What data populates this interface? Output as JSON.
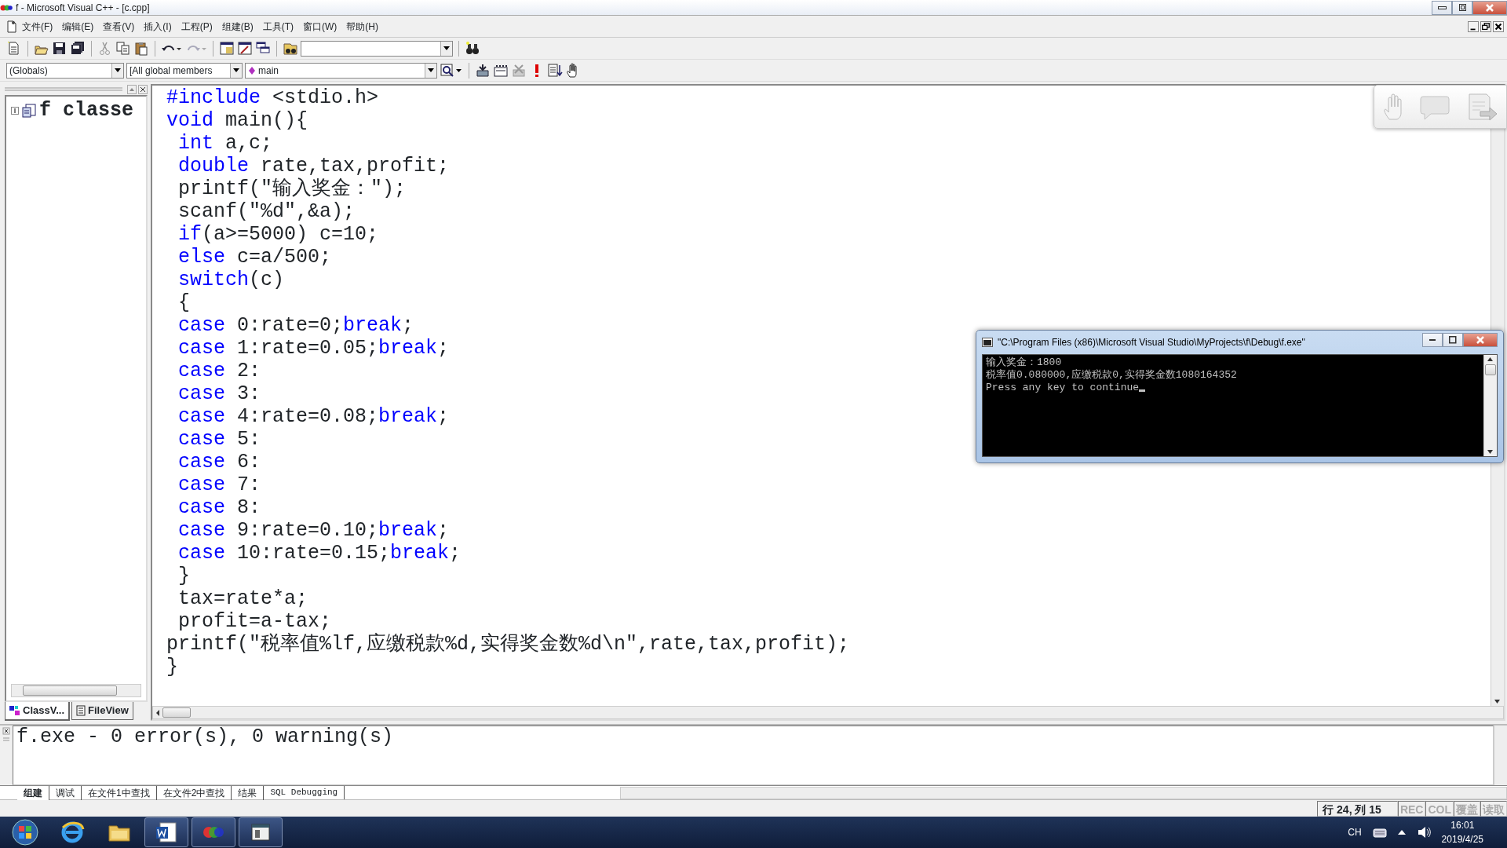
{
  "window": {
    "title": "f - Microsoft Visual C++ - [c.cpp]"
  },
  "menu": [
    "文件(F)",
    "编辑(E)",
    "查看(V)",
    "插入(I)",
    "工程(P)",
    "组建(B)",
    "工具(T)",
    "窗口(W)",
    "帮助(H)"
  ],
  "wizard_bar": {
    "class": "(Globals)",
    "filter": "[All global members",
    "function": "main"
  },
  "class_view": {
    "tree": [
      {
        "label": "f classe",
        "expanded": false
      }
    ],
    "tabs": [
      {
        "label": "ClassV...",
        "selected": true
      },
      {
        "label": "FileView",
        "selected": false
      }
    ]
  },
  "editor": {
    "lines": [
      [
        {
          "kind": "keyword",
          "text": "#include"
        },
        {
          "kind": "plain",
          "text": " <stdio.h>"
        }
      ],
      [
        {
          "kind": "keyword",
          "text": "void"
        },
        {
          "kind": "plain",
          "text": " main(){"
        }
      ],
      [
        {
          "kind": "keyword",
          "text": " int"
        },
        {
          "kind": "plain",
          "text": " a,c;"
        }
      ],
      [
        {
          "kind": "keyword",
          "text": " double"
        },
        {
          "kind": "plain",
          "text": " rate,tax,profit;"
        }
      ],
      [
        {
          "kind": "plain",
          "text": " printf(\"输入奖金：\");"
        }
      ],
      [
        {
          "kind": "plain",
          "text": " scanf(\"%d\",&a);"
        }
      ],
      [
        {
          "kind": "keyword",
          "text": " if"
        },
        {
          "kind": "plain",
          "text": "(a>=5000) c=10;"
        }
      ],
      [
        {
          "kind": "keyword",
          "text": " else"
        },
        {
          "kind": "plain",
          "text": " c=a/500;"
        }
      ],
      [
        {
          "kind": "keyword",
          "text": " switch"
        },
        {
          "kind": "plain",
          "text": "(c)"
        }
      ],
      [
        {
          "kind": "plain",
          "text": " {"
        }
      ],
      [
        {
          "kind": "keyword",
          "text": " case"
        },
        {
          "kind": "plain",
          "text": " 0:rate=0;"
        },
        {
          "kind": "keyword",
          "text": "break"
        },
        {
          "kind": "plain",
          "text": ";"
        }
      ],
      [
        {
          "kind": "keyword",
          "text": " case"
        },
        {
          "kind": "plain",
          "text": " 1:rate=0.05;"
        },
        {
          "kind": "keyword",
          "text": "break"
        },
        {
          "kind": "plain",
          "text": ";"
        }
      ],
      [
        {
          "kind": "keyword",
          "text": " case"
        },
        {
          "kind": "plain",
          "text": " 2:"
        }
      ],
      [
        {
          "kind": "keyword",
          "text": " case"
        },
        {
          "kind": "plain",
          "text": " 3:"
        }
      ],
      [
        {
          "kind": "keyword",
          "text": " case"
        },
        {
          "kind": "plain",
          "text": " 4:rate=0.08;"
        },
        {
          "kind": "keyword",
          "text": "break"
        },
        {
          "kind": "plain",
          "text": ";"
        }
      ],
      [
        {
          "kind": "keyword",
          "text": " case"
        },
        {
          "kind": "plain",
          "text": " 5:"
        }
      ],
      [
        {
          "kind": "keyword",
          "text": " case"
        },
        {
          "kind": "plain",
          "text": " 6:"
        }
      ],
      [
        {
          "kind": "keyword",
          "text": " case"
        },
        {
          "kind": "plain",
          "text": " 7:"
        }
      ],
      [
        {
          "kind": "keyword",
          "text": " case"
        },
        {
          "kind": "plain",
          "text": " 8:"
        }
      ],
      [
        {
          "kind": "keyword",
          "text": " case"
        },
        {
          "kind": "plain",
          "text": " 9:rate=0.10;"
        },
        {
          "kind": "keyword",
          "text": "break"
        },
        {
          "kind": "plain",
          "text": ";"
        }
      ],
      [
        {
          "kind": "keyword",
          "text": " case"
        },
        {
          "kind": "plain",
          "text": " 10:rate=0.15;"
        },
        {
          "kind": "keyword",
          "text": "break"
        },
        {
          "kind": "plain",
          "text": ";"
        }
      ],
      [
        {
          "kind": "plain",
          "text": " }"
        }
      ],
      [
        {
          "kind": "plain",
          "text": " tax=rate*a;"
        }
      ],
      [
        {
          "kind": "plain",
          "text": " profit=a-tax;"
        }
      ],
      [
        {
          "kind": "plain",
          "text": "printf(\"税率值%lf,应缴税款%d,实得奖金数%d\\n\",rate,tax,profit);"
        }
      ],
      [
        {
          "kind": "plain",
          "text": "}"
        }
      ]
    ]
  },
  "output": {
    "text": "f.exe - 0 error(s), 0 warning(s)",
    "tabs": [
      {
        "label": "组建",
        "selected": true
      },
      {
        "label": "调试",
        "selected": false
      },
      {
        "label": "在文件1中查找",
        "selected": false
      },
      {
        "label": "在文件2中查找",
        "selected": false
      },
      {
        "label": "结果",
        "selected": false
      },
      {
        "label": "SQL Debugging",
        "selected": false
      }
    ]
  },
  "status_bar": {
    "position": "行 24, 列 15",
    "indicators": [
      {
        "label": "REC",
        "active": false
      },
      {
        "label": "COL",
        "active": false
      },
      {
        "label": "覆盖",
        "active": false
      },
      {
        "label": "读取",
        "active": false
      }
    ]
  },
  "console": {
    "title": "\"C:\\Program Files (x86)\\Microsoft Visual Studio\\MyProjects\\f\\Debug\\f.exe\"",
    "lines": [
      "输入奖金：1800",
      "税率值0.080000,应缴税款0,实得奖金数1080164352",
      "Press any key to continue"
    ]
  },
  "taskbar": {
    "apps": [
      {
        "kind": "browser",
        "running": false
      },
      {
        "kind": "folder",
        "running": false
      },
      {
        "kind": "word",
        "running": true
      },
      {
        "kind": "ide",
        "running": true
      },
      {
        "kind": "window",
        "running": true
      }
    ],
    "tray": {
      "language": "CH",
      "time": "16:01",
      "date": "2019/4/25"
    }
  }
}
